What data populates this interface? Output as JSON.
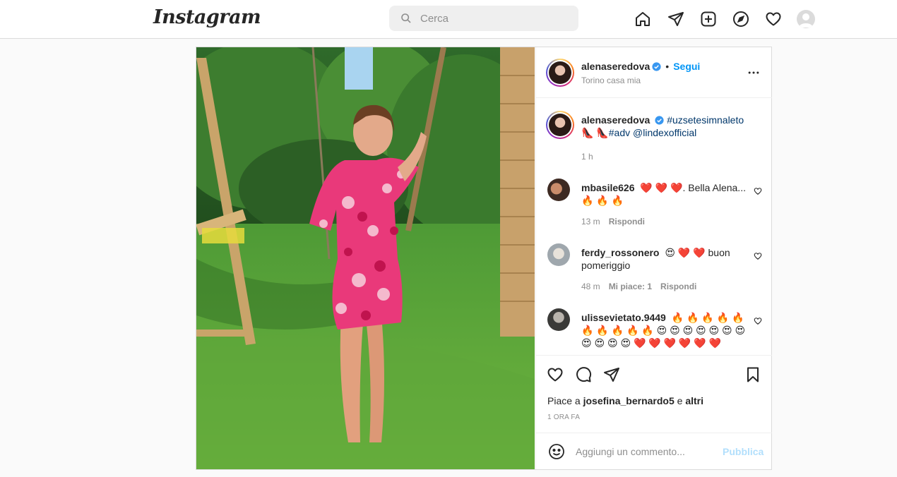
{
  "app": {
    "logo": "Instagram"
  },
  "search": {
    "placeholder": "Cerca"
  },
  "nav": {
    "icons": [
      "home-icon",
      "direct-message-icon",
      "new-post-icon",
      "explore-icon",
      "activity-heart-icon",
      "profile-avatar"
    ]
  },
  "post": {
    "author": "alenaseredova",
    "follow_label": "Segui",
    "separator": "•",
    "location": "Torino casa mia",
    "caption": {
      "username": "alenaseredova",
      "tag1": "#uzsetesimnaleto",
      "emoji1": "👠",
      "emoji2": "👠",
      "tag2": "#adv",
      "mention": "@lindexofficial",
      "time": "1 h"
    },
    "comments": [
      {
        "username": "mbasile626",
        "text": "❤️ ❤️ ❤️. Bella Alena... 🔥 🔥 🔥",
        "time": "13 m",
        "likes": "",
        "reply": "Rispondi"
      },
      {
        "username": "ferdy_rossonero",
        "text": "😍 ❤️ ❤️ buon pomeriggio",
        "time": "48 m",
        "likes": "Mi piace: 1",
        "reply": "Rispondi"
      },
      {
        "username": "ulissevietato.9449",
        "text": "🔥 🔥 🔥 🔥 🔥 🔥 🔥 🔥 🔥 🔥 😍 😍 😍 😍 😍 😍 😍 😍 😍 😍 😍 ❤️ ❤️ ❤️ ❤️ ❤️ ❤️",
        "time": "",
        "likes": "",
        "reply": ""
      }
    ],
    "likes": {
      "prefix": "Piace a",
      "user": "josefina_bernardo5",
      "and": "e",
      "others": "altri"
    },
    "timestamp": "1 ORA FA",
    "add_comment": {
      "placeholder": "Aggiungi un commento...",
      "post_label": "Pubblica"
    }
  },
  "colors": {
    "accent": "#0095f6",
    "heart": "#ed4956",
    "muted": "#8e8e8e",
    "border": "#dbdbdb"
  }
}
